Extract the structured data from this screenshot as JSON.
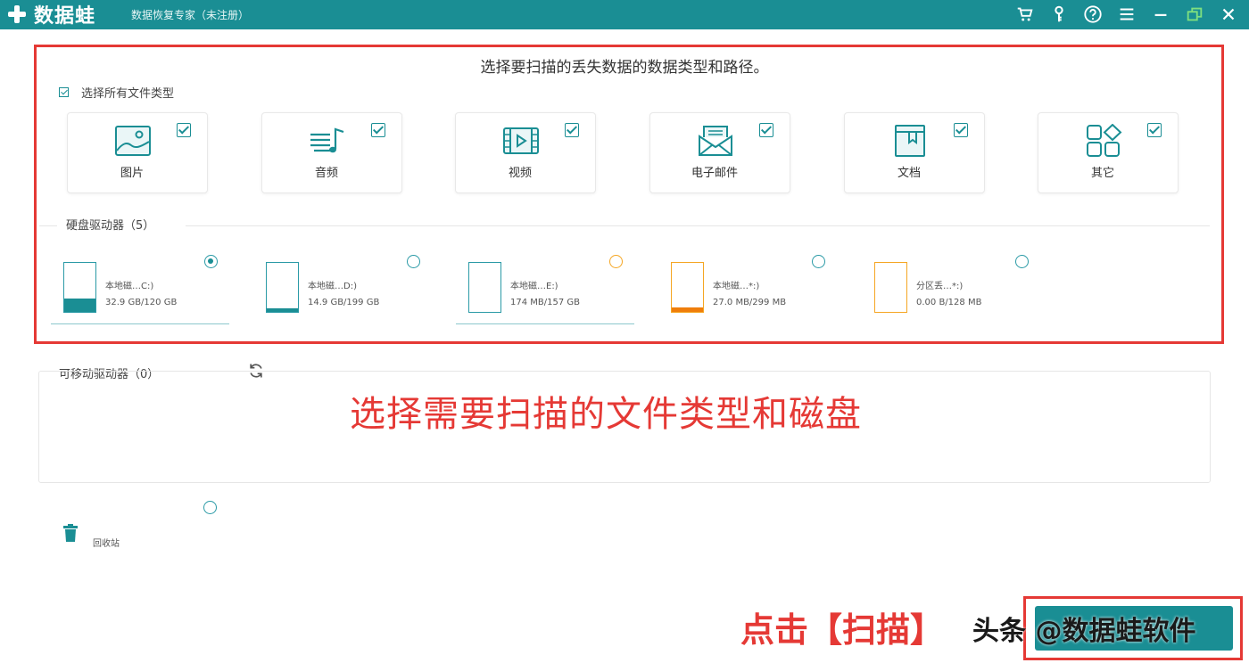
{
  "app": {
    "name": "数据蛙",
    "subtitle": "数据恢复专家（未注册）"
  },
  "toolbar": {
    "icons": [
      "cart-icon",
      "key-icon",
      "help-icon",
      "menu-icon",
      "minimize-icon",
      "restore-icon",
      "close-icon"
    ]
  },
  "instruction": "选择要扫描的丢失数据的数据类型和路径。",
  "select_all": {
    "label": "选择所有文件类型",
    "checked": true
  },
  "file_types": [
    {
      "label": "图片",
      "icon": "image-icon",
      "checked": true
    },
    {
      "label": "音频",
      "icon": "audio-icon",
      "checked": true
    },
    {
      "label": "视频",
      "icon": "video-icon",
      "checked": true
    },
    {
      "label": "电子邮件",
      "icon": "email-icon",
      "checked": true
    },
    {
      "label": "文档",
      "icon": "document-icon",
      "checked": true
    },
    {
      "label": "其它",
      "icon": "other-icon",
      "checked": true
    }
  ],
  "hard_drives": {
    "title": "硬盘驱动器（5）",
    "items": [
      {
        "name": "本地磁…C:)",
        "size": "32.9 GB/120 GB",
        "fill": 0.27,
        "selected": true,
        "style": "teal"
      },
      {
        "name": "本地磁…D:)",
        "size": "14.9 GB/199 GB",
        "fill": 0.08,
        "selected": false,
        "style": "teal"
      },
      {
        "name": "本地磁…E:)",
        "size": "174 MB/157 GB",
        "fill": 0.0,
        "selected": false,
        "style": "teal"
      },
      {
        "name": "本地磁…*:)",
        "size": "27.0 MB/299 MB",
        "fill": 0.09,
        "selected": false,
        "style": "orange"
      },
      {
        "name": "分区丢…*:)",
        "size": "0.00  B/128 MB",
        "fill": 0.0,
        "selected": false,
        "style": "orange"
      }
    ]
  },
  "removable": {
    "title": "可移动驱动器（0）"
  },
  "recycle_bin": {
    "label": "回收站"
  },
  "annotations": {
    "main": "选择需要扫描的文件类型和磁盘",
    "click": "点击【扫描】"
  },
  "watermark": "头条 @数据蛙软件",
  "colors": {
    "brand": "#1a8e94",
    "annotation": "#e53935",
    "orange": "#ef7d0b"
  }
}
